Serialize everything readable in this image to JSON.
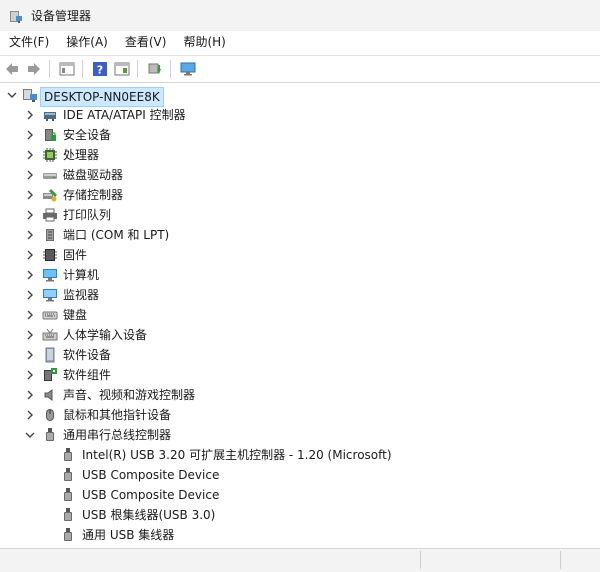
{
  "window": {
    "title": "设备管理器"
  },
  "menu": {
    "items": [
      "文件(F)",
      "操作(A)",
      "查看(V)",
      "帮助(H)"
    ]
  },
  "tree": {
    "root": "DESKTOP-NN0EE8K",
    "categories": [
      {
        "label": "IDE ATA/ATAPI 控制器",
        "icon": "ide-controller-icon"
      },
      {
        "label": "安全设备",
        "icon": "security-device-icon"
      },
      {
        "label": "处理器",
        "icon": "processor-icon"
      },
      {
        "label": "磁盘驱动器",
        "icon": "disk-drive-icon"
      },
      {
        "label": "存储控制器",
        "icon": "storage-controller-icon"
      },
      {
        "label": "打印队列",
        "icon": "printer-icon"
      },
      {
        "label": "端口 (COM 和 LPT)",
        "icon": "port-icon"
      },
      {
        "label": "固件",
        "icon": "firmware-icon"
      },
      {
        "label": "计算机",
        "icon": "computer-icon"
      },
      {
        "label": "监视器",
        "icon": "monitor-icon"
      },
      {
        "label": "键盘",
        "icon": "keyboard-icon"
      },
      {
        "label": "人体学输入设备",
        "icon": "hid-icon"
      },
      {
        "label": "软件设备",
        "icon": "software-device-icon"
      },
      {
        "label": "软件组件",
        "icon": "software-component-icon"
      },
      {
        "label": "声音、视频和游戏控制器",
        "icon": "sound-icon"
      },
      {
        "label": "鼠标和其他指针设备",
        "icon": "mouse-icon"
      },
      {
        "label": "通用串行总线控制器",
        "icon": "usb-icon",
        "expanded": true
      }
    ],
    "usb_children": [
      "Intel(R) USB 3.20 可扩展主机控制器 - 1.20 (Microsoft)",
      "USB Composite Device",
      "USB Composite Device",
      "USB 根集线器(USB 3.0)",
      "通用 USB 集线器"
    ]
  }
}
